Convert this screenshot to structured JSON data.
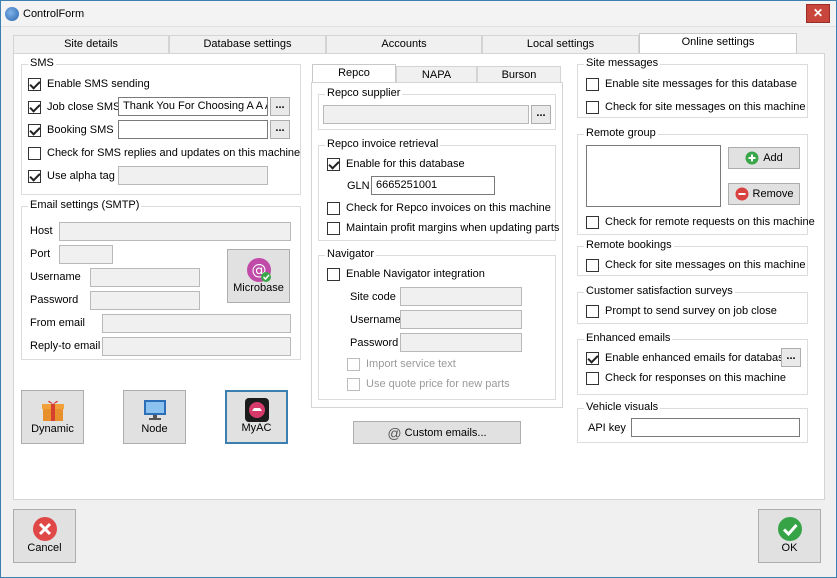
{
  "window": {
    "title": "ControlForm"
  },
  "tabs": [
    "Site details",
    "Database settings",
    "Accounts",
    "Local settings",
    "Online settings"
  ],
  "sms": {
    "title": "SMS",
    "enable": {
      "label": "Enable SMS sending",
      "checked": true
    },
    "job_close": {
      "label": "Job close SMS",
      "checked": true,
      "value": "Thank You For Choosing A A Au"
    },
    "booking": {
      "label": "Booking SMS",
      "checked": true,
      "value": ""
    },
    "replies": {
      "label": "Check for SMS replies and updates on this machine",
      "checked": false
    },
    "alpha": {
      "label": "Use alpha tag",
      "checked": true,
      "value": ""
    }
  },
  "email": {
    "title": "Email settings (SMTP)",
    "host": "Host",
    "port": "Port",
    "username": "Username",
    "password": "Password",
    "from": "From email",
    "reply": "Reply-to email",
    "microbase": "Microbase"
  },
  "apps": {
    "dynamic": "Dynamic",
    "node": "Node",
    "myac": "MyAC"
  },
  "supplier_tabs": [
    "Repco",
    "NAPA",
    "Burson"
  ],
  "repco": {
    "supplier_title": "Repco supplier",
    "supplier_value": "",
    "invoice_title": "Repco invoice retrieval",
    "enable_db": {
      "label": "Enable for this database",
      "checked": true
    },
    "gln_label": "GLN",
    "gln_value": "6665251001",
    "check_invoices": {
      "label": "Check for Repco invoices on this machine",
      "checked": false
    },
    "maintain_margins": {
      "label": "Maintain profit margins when updating parts",
      "checked": false
    }
  },
  "navigator": {
    "title": "Navigator",
    "enable": {
      "label": "Enable Navigator integration",
      "checked": false
    },
    "site_code": "Site code",
    "username": "Username",
    "password": "Password",
    "import_service": {
      "label": "Import service text",
      "checked": false
    },
    "quote_price": {
      "label": "Use quote price for new parts",
      "checked": false
    }
  },
  "custom_emails": "Custom emails...",
  "site_messages": {
    "title": "Site messages",
    "enable_db": {
      "label": "Enable site messages for this database",
      "checked": false
    },
    "check_machine": {
      "label": "Check for site messages on this machine",
      "checked": false
    }
  },
  "remote_group": {
    "title": "Remote group",
    "add": "Add",
    "remove": "Remove",
    "check": {
      "label": "Check for remote requests on this machine",
      "checked": false
    }
  },
  "remote_bookings": {
    "title": "Remote bookings",
    "check": {
      "label": "Check for site messages on this machine",
      "checked": false
    }
  },
  "surveys": {
    "title": "Customer satisfaction surveys",
    "prompt": {
      "label": "Prompt to send survey on job close",
      "checked": false
    }
  },
  "enhanced": {
    "title": "Enhanced emails",
    "enable": {
      "label": "Enable enhanced emails for database",
      "checked": true
    },
    "check": {
      "label": "Check for responses on this machine",
      "checked": false
    }
  },
  "vehicle": {
    "title": "Vehicle visuals",
    "api_label": "API key",
    "api_value": ""
  },
  "footer": {
    "cancel": "Cancel",
    "ok": "OK"
  },
  "colors": {
    "cancel_red": "#e04848",
    "ok_green": "#37a347",
    "add_green": "#3aa64a",
    "remove_red": "#d94040"
  }
}
